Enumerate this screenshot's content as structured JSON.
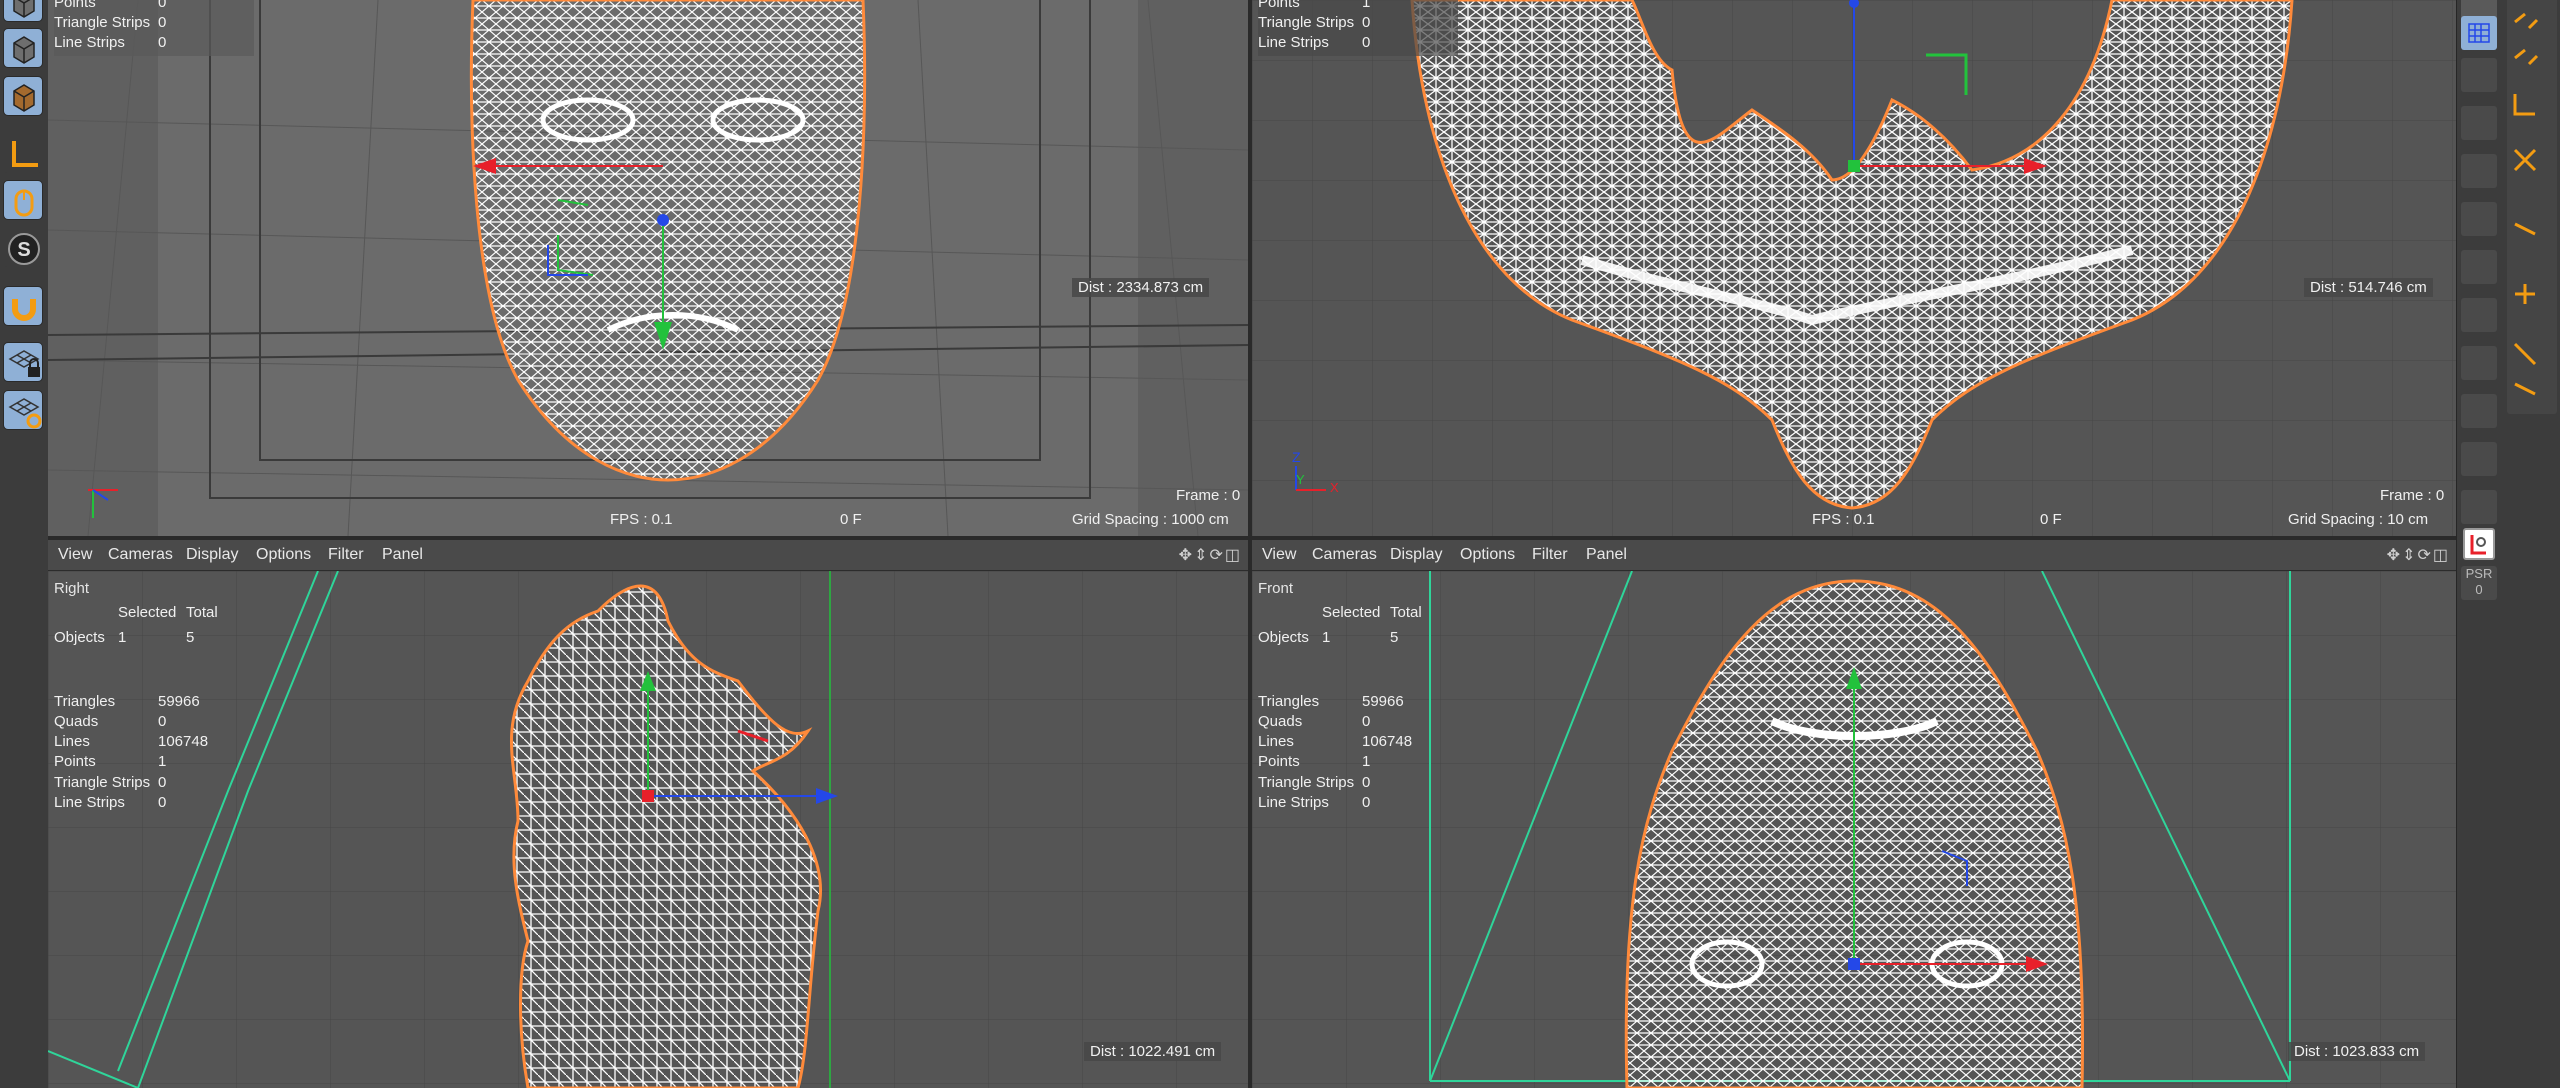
{
  "menu": [
    "View",
    "Cameras",
    "Display",
    "Options",
    "Filter",
    "Panel"
  ],
  "stats_labels": {
    "selected": "Selected",
    "total": "Total",
    "objects": "Objects",
    "triangles": "Triangles",
    "quads": "Quads",
    "lines": "Lines",
    "points": "Points",
    "triangle_strips": "Triangle Strips",
    "line_strips": "Line Strips"
  },
  "colors": {
    "wire": "#ffffff",
    "outline": "#ff8a3a",
    "axis_x": "#e8202a",
    "axis_y": "#22c23c",
    "axis_z": "#2448e8",
    "camera_frame": "#2fd59a",
    "tool_accent": "#f39c12",
    "tool_bg": "#8fb0d6"
  },
  "viewports": {
    "perspective": {
      "stats": {
        "points": "0",
        "triangle_strips": "0",
        "line_strips": "0"
      },
      "dist": "Dist : 2334.873 cm",
      "frame": "Frame : 0",
      "fps": "FPS : 0.1",
      "frame_f": "0 F",
      "grid": "Grid Spacing : 1000 cm"
    },
    "top": {
      "stats": {
        "points": "1",
        "triangle_strips": "0",
        "line_strips": "0"
      },
      "dist": "Dist : 514.746 cm",
      "frame": "Frame : 0",
      "fps": "FPS : 0.1",
      "frame_f": "0 F",
      "grid": "Grid Spacing : 10 cm",
      "axis_z": "Z",
      "axis_y": "Y",
      "axis_x": "X"
    },
    "right": {
      "title": "Right",
      "stats": {
        "objects_selected": "1",
        "objects_total": "5",
        "triangles": "59966",
        "quads": "0",
        "lines": "106748",
        "points": "1",
        "triangle_strips": "0",
        "line_strips": "0"
      },
      "dist": "Dist : 1022.491 cm"
    },
    "front": {
      "title": "Front",
      "stats": {
        "objects_selected": "1",
        "objects_total": "5",
        "triangles": "59966",
        "quads": "0",
        "lines": "106748",
        "points": "1",
        "triangle_strips": "0",
        "line_strips": "0"
      },
      "dist": "Dist : 1023.833 cm"
    }
  },
  "toolbar_left": [
    "cube-icon",
    "cube-icon",
    "cube-icon",
    "axis-icon",
    "mouse-icon",
    "s-icon",
    "magnet-icon",
    "grid-lock-icon",
    "grid-gear-icon"
  ],
  "toolbar_right": {
    "psr_label": "PSR",
    "psr_value": "0"
  }
}
